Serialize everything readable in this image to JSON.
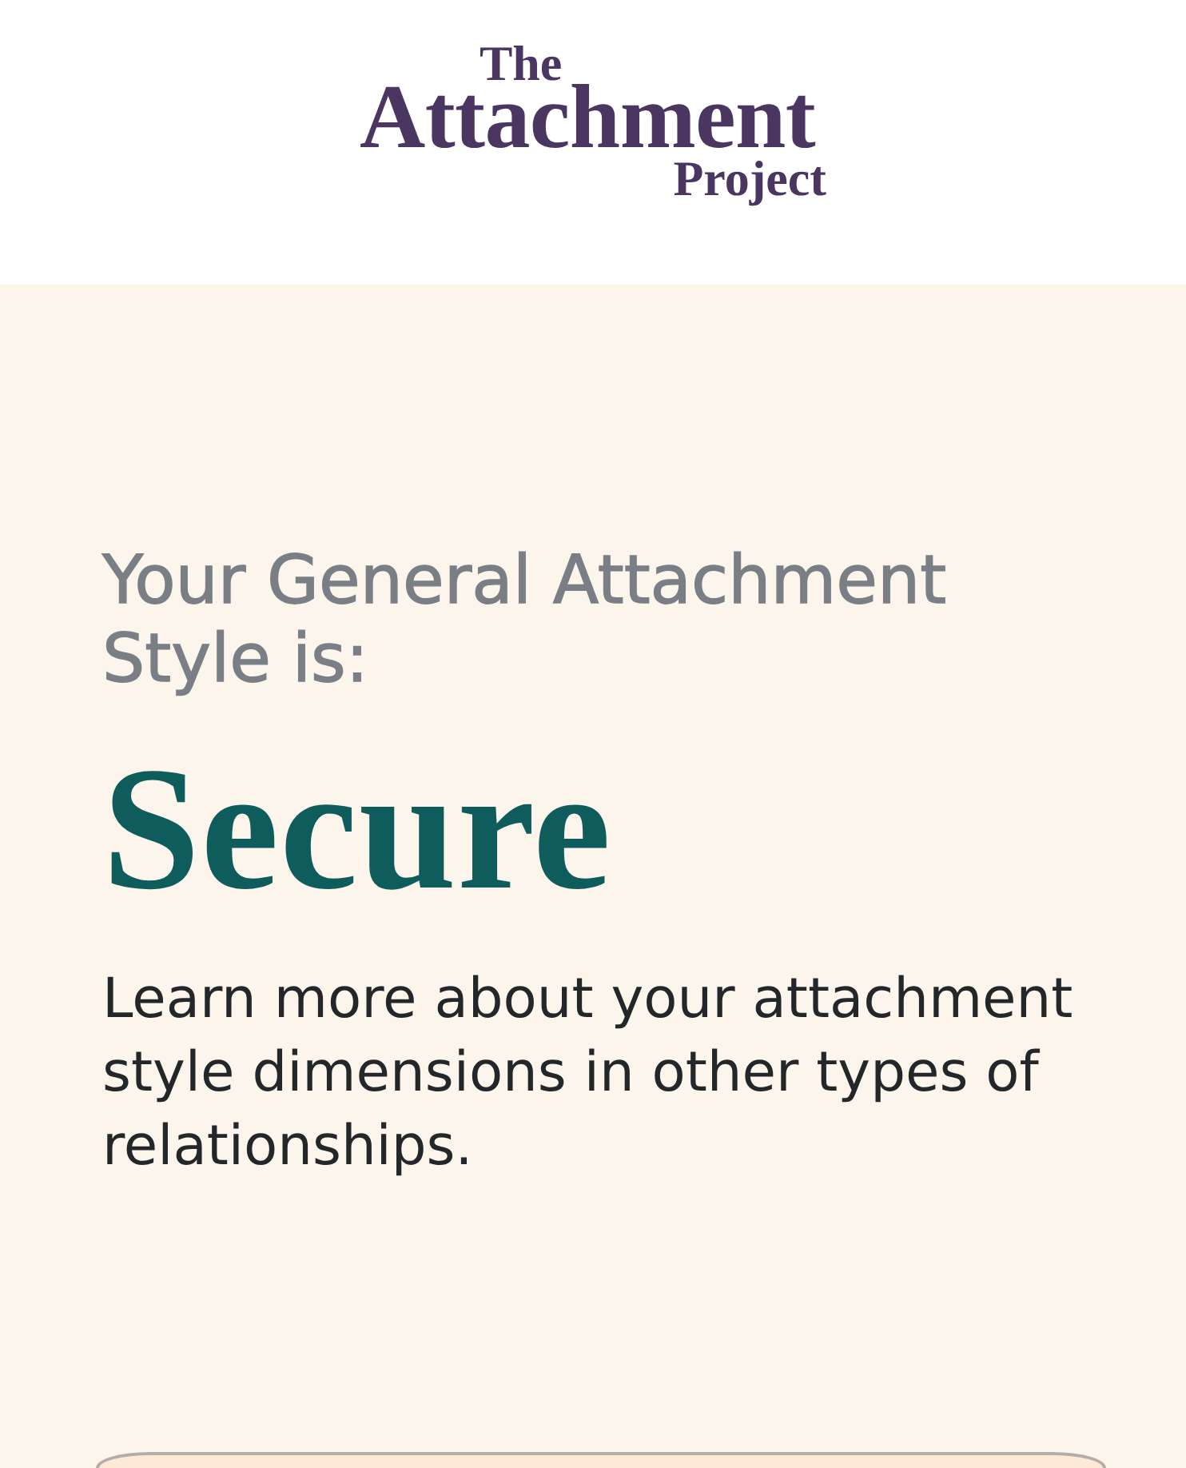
{
  "header": {
    "logo": {
      "lines": [
        "The",
        "Attachment",
        "Project"
      ]
    }
  },
  "result": {
    "heading": "Your General Attachment Style is:",
    "style": "Secure",
    "description": "Learn more about your attachment style dimensions in other types of relationships."
  }
}
